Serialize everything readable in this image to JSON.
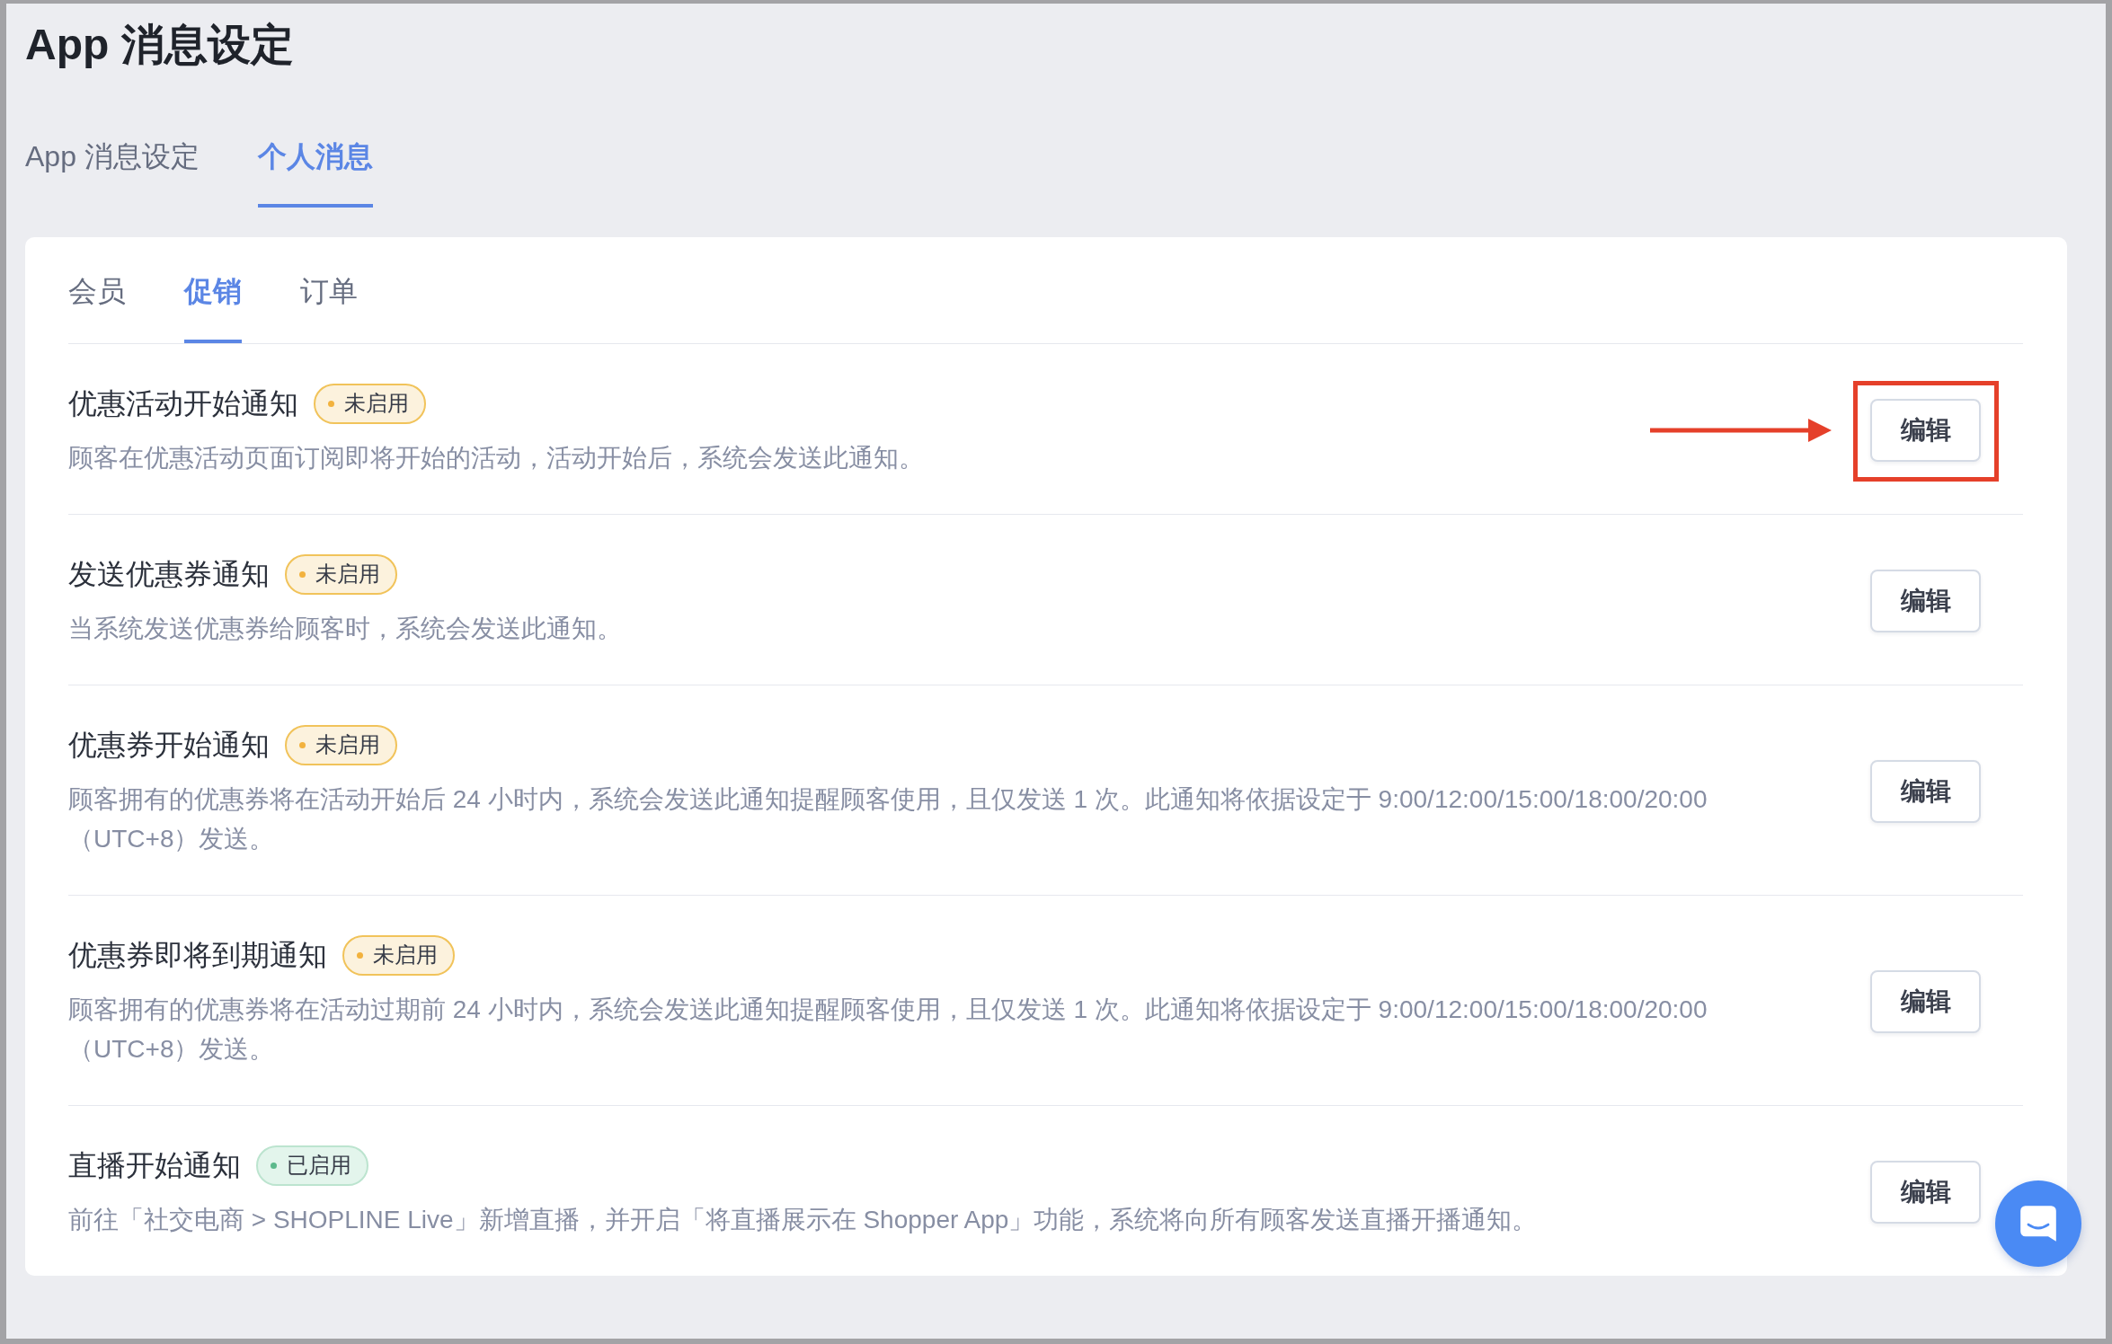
{
  "page": {
    "title": "App 消息设定"
  },
  "tabs": [
    {
      "label": "App 消息设定",
      "selected": false
    },
    {
      "label": "个人消息",
      "selected": true
    }
  ],
  "card": {
    "tabs": [
      {
        "label": "会员",
        "selected": false
      },
      {
        "label": "促销",
        "selected": true
      },
      {
        "label": "订单",
        "selected": false
      }
    ],
    "notifications": [
      {
        "title": "优惠活动开始通知",
        "status": "未启用",
        "enabled": false,
        "description": "顾客在优惠活动页面订阅即将开始的活动，活动开始后，系统会发送此通知。",
        "button": "编辑",
        "highlighted": true
      },
      {
        "title": "发送优惠券通知",
        "status": "未启用",
        "enabled": false,
        "description": "当系统发送优惠券给顾客时，系统会发送此通知。",
        "button": "编辑",
        "highlighted": false
      },
      {
        "title": "优惠券开始通知",
        "status": "未启用",
        "enabled": false,
        "description": "顾客拥有的优惠券将在活动开始后 24 小时内，系统会发送此通知提醒顾客使用，且仅发送 1 次。此通知将依据设定于 9:00/12:00/15:00/18:00/20:00（UTC+8）发送。",
        "button": "编辑",
        "highlighted": false
      },
      {
        "title": "优惠券即将到期通知",
        "status": "未启用",
        "enabled": false,
        "description": "顾客拥有的优惠券将在活动过期前 24 小时内，系统会发送此通知提醒顾客使用，且仅发送 1 次。此通知将依据设定于 9:00/12:00/15:00/18:00/20:00（UTC+8）发送。",
        "button": "编辑",
        "highlighted": false
      },
      {
        "title": "直播开始通知",
        "status": "已启用",
        "enabled": true,
        "description": "前往「社交电商 > SHOPLINE Live」新增直播，并开启「将直播展示在 Shopper App」功能，系统将向所有顾客发送直播开播通知。",
        "button": "编辑",
        "highlighted": false
      }
    ]
  }
}
